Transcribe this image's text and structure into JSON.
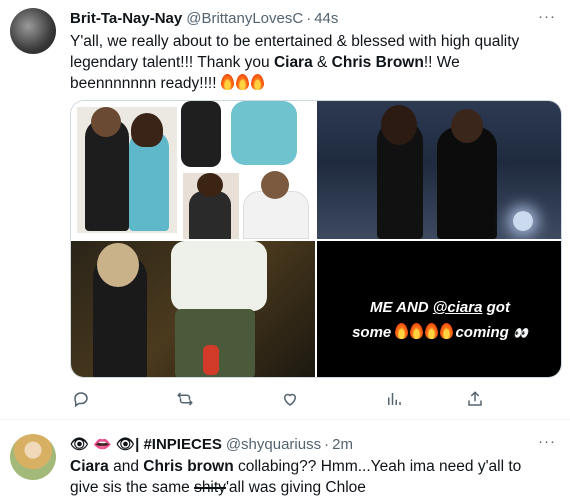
{
  "tweets": [
    {
      "name": "Brit-Ta-Nay-Nay",
      "handle": "@BrittanyLovesC",
      "time": "44s",
      "text": {
        "part1": "Y'all, we really about to be entertained & blessed with high quality legendary talent!!! Thank you ",
        "bold1": "Ciara",
        "part2": " & ",
        "bold2": "Chris Brown",
        "part3": "!! We beennnnnnn ready!!!! "
      },
      "media": {
        "caption_line1_prefix": "ME AND ",
        "caption_mention": "@ciara",
        "caption_line1_suffix": " got",
        "caption_line2_prefix": "some ",
        "caption_line2_suffix": "coming ",
        "caption_eyes": "👀"
      }
    },
    {
      "name": "👁 👄 👁| #INPIECES",
      "handle": "@shyquariuss",
      "time": "2m",
      "text": {
        "bold1": "Ciara",
        "part1": " and ",
        "bold2": "Chris brown",
        "part2": " collabing?? Hmm...Yeah ima need y'all to give sis the same ",
        "struck": "shity",
        "part3": "'all was giving Chloe"
      }
    }
  ],
  "ui": {
    "more_label": "···",
    "dot": "·"
  },
  "icons": [
    "reply-icon",
    "retweet-icon",
    "like-icon",
    "views-icon",
    "share-icon"
  ],
  "colors": {
    "text": "#0f1419",
    "secondary": "#536471",
    "divider": "#eff3f4"
  }
}
